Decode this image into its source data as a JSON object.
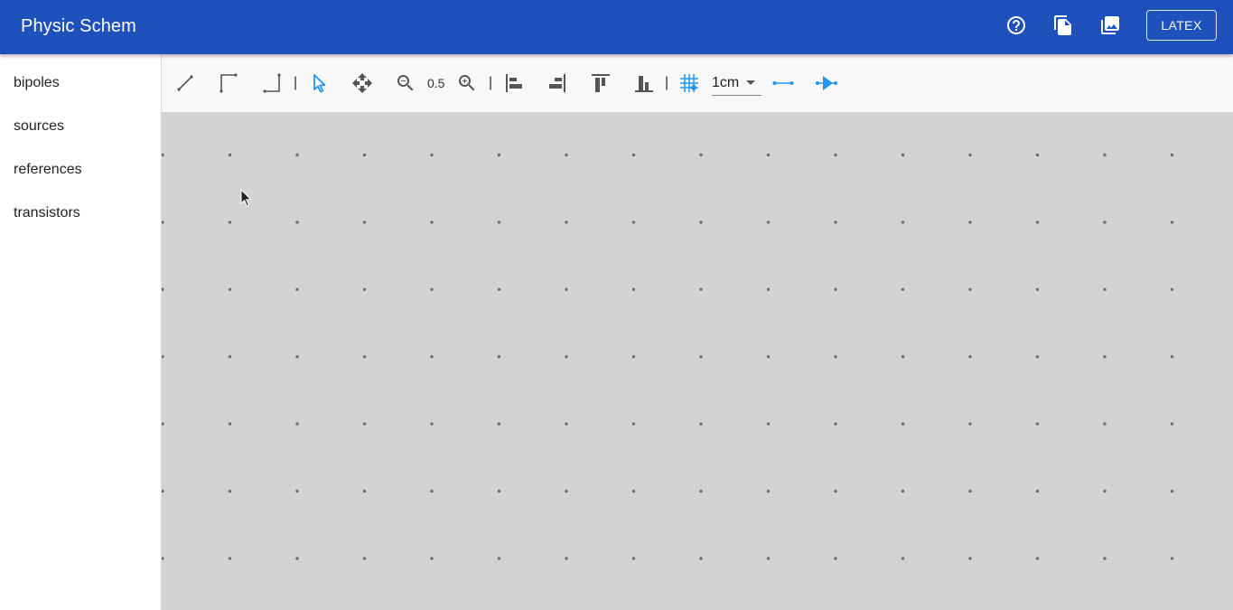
{
  "app": {
    "title": "Physic Schem",
    "icons": {
      "help": "help-circle-icon",
      "copy": "copy-document-icon",
      "image": "image-gallery-icon"
    },
    "latex_button": "LATEX"
  },
  "sidebar": {
    "items": [
      {
        "label": "bipoles"
      },
      {
        "label": "sources"
      },
      {
        "label": "references"
      },
      {
        "label": "transistors"
      }
    ]
  },
  "toolbar": {
    "separator": "|",
    "zoom_level": "0.5",
    "grid_size": "1cm",
    "accent_color": "#2196f3",
    "tools": [
      {
        "name": "line-tool-icon"
      },
      {
        "name": "corner-wire-up-icon"
      },
      {
        "name": "corner-wire-down-icon"
      },
      {
        "name": "select-pointer-icon",
        "active": true
      },
      {
        "name": "move-arrows-icon"
      },
      {
        "name": "zoom-out-icon"
      },
      {
        "name": "zoom-in-icon"
      },
      {
        "name": "align-left-icon"
      },
      {
        "name": "align-right-icon"
      },
      {
        "name": "align-top-icon"
      },
      {
        "name": "align-bottom-icon"
      },
      {
        "name": "grid-snap-icon"
      },
      {
        "name": "wire-node-icon"
      },
      {
        "name": "component-arrow-icon"
      }
    ]
  },
  "colors": {
    "appbar": "#1f51bc",
    "canvas": "#d3d3d3",
    "grid_dot": "#6e6e6e",
    "toolbar": "#f8f8f8"
  }
}
